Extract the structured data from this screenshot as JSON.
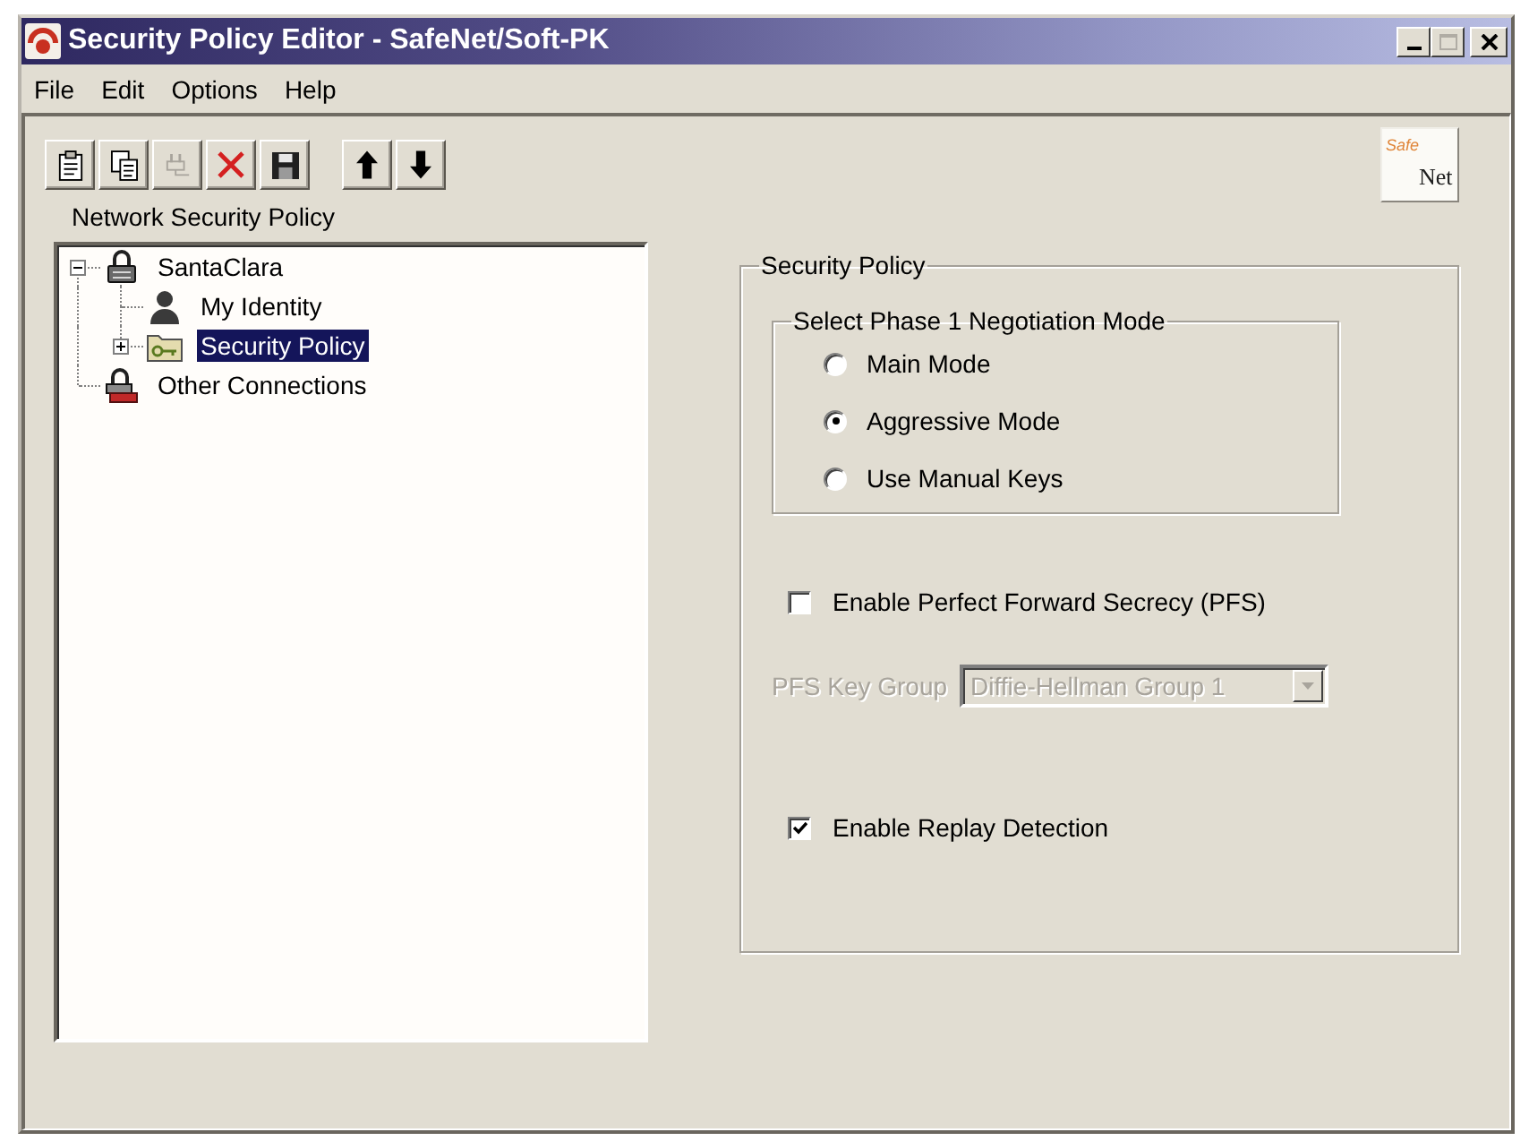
{
  "window": {
    "title": "Security Policy Editor - SafeNet/Soft-PK",
    "controls": [
      {
        "kind": "minimize",
        "disabled": false
      },
      {
        "kind": "maximize",
        "disabled": true
      },
      {
        "kind": "close",
        "disabled": false
      }
    ]
  },
  "menu": [
    "File",
    "Edit",
    "Options",
    "Help"
  ],
  "toolbar": [
    [
      {
        "kind": "clipboard",
        "disabled": false
      },
      {
        "kind": "copy",
        "disabled": false
      },
      {
        "kind": "plug",
        "disabled": true
      },
      {
        "kind": "delete",
        "disabled": false
      },
      {
        "kind": "save",
        "disabled": false
      }
    ],
    [
      {
        "kind": "up",
        "disabled": false
      },
      {
        "kind": "down",
        "disabled": false
      }
    ]
  ],
  "logo": {
    "text_1": "Safe",
    "text_2": "Net"
  },
  "tree": {
    "title": "Network Security Policy",
    "items": [
      {
        "label": "SantaClara",
        "kind": "connection",
        "expanded": true,
        "selected": false,
        "children": [
          {
            "label": "My Identity",
            "kind": "identity",
            "selected": false
          },
          {
            "label": "Security Policy",
            "kind": "policy",
            "expanded": false,
            "selected": true
          }
        ]
      },
      {
        "label": "Other Connections",
        "kind": "other",
        "selected": false
      }
    ]
  },
  "policy": {
    "title": "Security Policy",
    "mode_group": {
      "title": "Select Phase 1 Negotiation Mode",
      "options": [
        {
          "label": "Main Mode",
          "selected": false
        },
        {
          "label": "Aggressive Mode",
          "selected": true
        },
        {
          "label": "Use Manual Keys",
          "selected": false
        }
      ]
    },
    "pfs": {
      "label": "Enable Perfect Forward Secrecy (PFS)",
      "checked": false
    },
    "key_group": {
      "label": "PFS Key Group",
      "value": "Diffie-Hellman Group 1",
      "disabled": true
    },
    "replay": {
      "label": "Enable Replay Detection",
      "checked": true
    }
  }
}
